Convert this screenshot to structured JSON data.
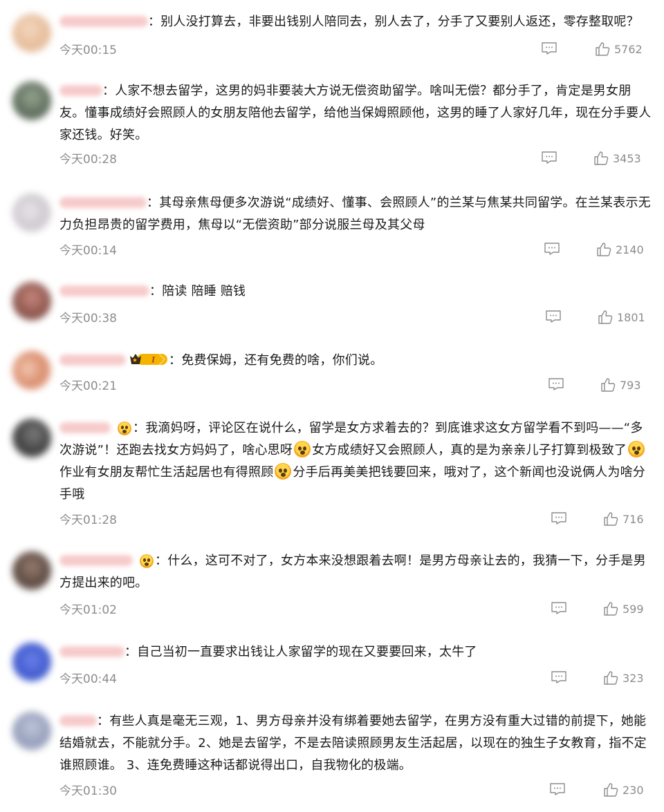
{
  "colors": {
    "text": "#1a1a1a",
    "meta": "#8c8c8c",
    "badge_gold": "#f5b400"
  },
  "comments": [
    {
      "text_parts": [
        "：别人没打算去，非要出钱别人陪同去，别人去了，分手了又要别人返还，零存整取呢？"
      ],
      "time": "今天00:15",
      "likes": "5762"
    },
    {
      "text_parts": [
        "：人家不想去留学，这男的妈非要装大方说无偿资助留学。啥叫无偿？都分手了，肯定是男女朋友。懂事成绩好会照顾人的女朋友陪他去留学，给他当保姆照顾他，这男的睡了人家好几年，现在分手要人家还钱。好笑。"
      ],
      "time": "今天00:28",
      "likes": "3453"
    },
    {
      "text_parts": [
        "：其母亲焦母便多次游说“成绩好、懂事、会照顾人”的兰某与焦某共同留学。在兰某表示无力负担昂贵的留学费用，焦母以“无偿资助”部分说服兰母及其父母"
      ],
      "time": "今天00:14",
      "likes": "2140"
    },
    {
      "text_parts": [
        "：陪读 陪睡 赔钱"
      ],
      "time": "今天00:38",
      "likes": "1801"
    },
    {
      "badge_level": "I",
      "text_parts": [
        "：免费保姆，还有免费的啥，你们说。"
      ],
      "time": "今天00:21",
      "likes": "793"
    },
    {
      "text_parts": [
        "：我滴妈呀，评论区在说什么，留学是女方求着去的？到底谁求这女方留学看不到吗——“多次游说”！还跑去找女方妈妈了，啥心思呀",
        "女方成绩好又会照顾人，真的是为亲亲儿子打算到极致了",
        "作业有女朋友帮忙生活起居也有得照顾",
        "分手后再美美把钱要回来，哦对了，这个新闻也没说俩人为啥分手哦"
      ],
      "time": "今天01:28",
      "likes": "716"
    },
    {
      "text_parts": [
        "：什么，这可不对了，女方本来没想跟着去啊！是男方母亲让去的，我猜一下，分手是男方提出来的吧。"
      ],
      "time": "今天01:02",
      "likes": "599"
    },
    {
      "text_parts": [
        "：自己当初一直要求出钱让人家留学的现在又要要回来，太牛了"
      ],
      "time": "今天00:44",
      "likes": "323"
    },
    {
      "text_parts": [
        "：有些人真是毫无三观，1、男方母亲并没有绑着要她去留学，在男方没有重大过错的前提下，她能结婚就去，不能就分手。2、她是去留学，不是去陪读照顾男友生活起居，以现在的独生子女教育，指不定谁照顾谁。 3、连免费睡这种话都说得出口，自我物化的极端。"
      ],
      "time": "今天01:30",
      "likes": "230"
    }
  ]
}
